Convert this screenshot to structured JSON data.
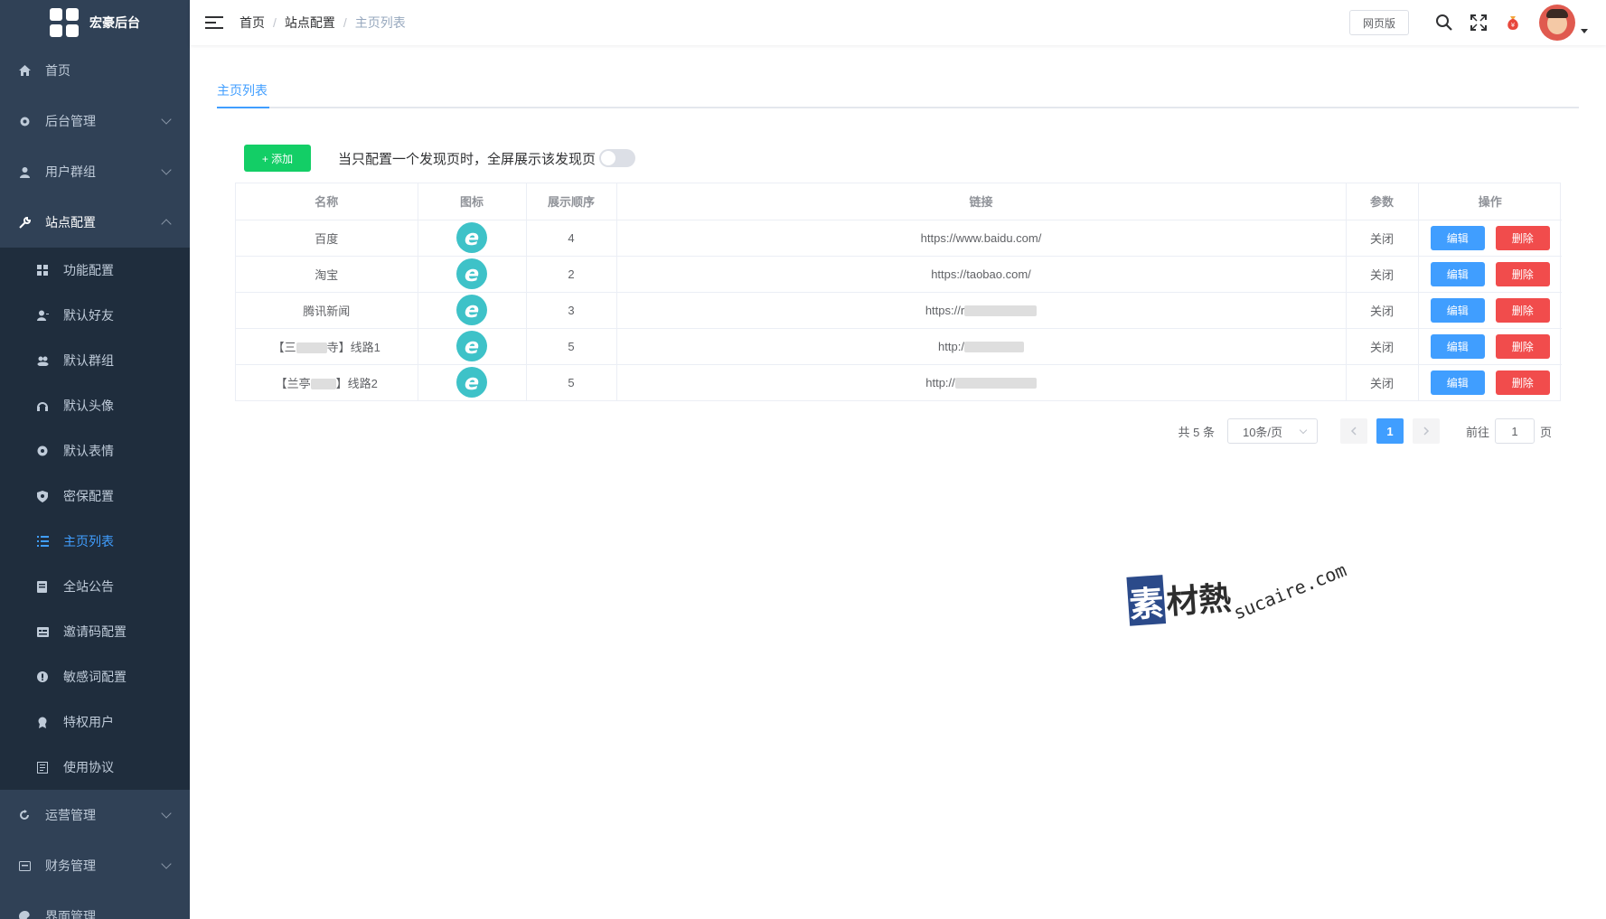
{
  "app": {
    "title": "宏豪后台"
  },
  "sidebar": {
    "items": [
      {
        "label": "首页",
        "icon": "home-icon"
      },
      {
        "label": "后台管理",
        "icon": "gear-icon"
      },
      {
        "label": "用户群组",
        "icon": "user-icon"
      },
      {
        "label": "站点配置",
        "icon": "wrench-icon"
      }
    ],
    "submenu": [
      {
        "label": "功能配置",
        "icon": "grid-icon"
      },
      {
        "label": "默认好友",
        "icon": "user-plus-icon"
      },
      {
        "label": "默认群组",
        "icon": "group-icon"
      },
      {
        "label": "默认头像",
        "icon": "headset-icon"
      },
      {
        "label": "默认表情",
        "icon": "smile-icon"
      },
      {
        "label": "密保配置",
        "icon": "shield-icon"
      },
      {
        "label": "主页列表",
        "icon": "list-icon"
      },
      {
        "label": "全站公告",
        "icon": "notice-icon"
      },
      {
        "label": "邀请码配置",
        "icon": "card-icon"
      },
      {
        "label": "敏感词配置",
        "icon": "alert-icon"
      },
      {
        "label": "特权用户",
        "icon": "badge-icon"
      },
      {
        "label": "使用协议",
        "icon": "document-icon"
      }
    ],
    "bottom_items": [
      {
        "label": "运营管理",
        "icon": "refresh-icon"
      },
      {
        "label": "财务管理",
        "icon": "wallet-icon"
      },
      {
        "label": "界面管理",
        "icon": "palette-icon"
      }
    ]
  },
  "header": {
    "breadcrumb": [
      "首页",
      "站点配置",
      "主页列表"
    ],
    "web_button": "网页版"
  },
  "main": {
    "tab": "主页列表",
    "add_button": "+ 添加",
    "toggle_label": "当只配置一个发现页时，全屏展示该发现页",
    "toggle_on": false,
    "table": {
      "headers": [
        "名称",
        "图标",
        "展示顺序",
        "链接",
        "参数",
        "操作"
      ],
      "rows": [
        {
          "name": "百度",
          "order": "4",
          "link": "https://www.baidu.com/",
          "param": "关闭"
        },
        {
          "name": "淘宝",
          "order": "2",
          "link": "https://taobao.com/",
          "param": "关闭"
        },
        {
          "name": "腾讯新闻",
          "order": "3",
          "link": "https://r",
          "param": "关闭"
        },
        {
          "name_prefix": "【三",
          "name_suffix": "寺】线路1",
          "order": "5",
          "link": "http:/",
          "param": "关闭"
        },
        {
          "name_prefix": "【兰亭",
          "name_suffix": "】线路2",
          "order": "5",
          "link": "http://",
          "param": "关闭"
        }
      ],
      "edit_label": "编辑",
      "delete_label": "删除"
    },
    "pagination": {
      "total": "共 5 条",
      "page_size": "10条/页",
      "current_page": "1",
      "goto_label": "前往",
      "goto_value": "1",
      "page_unit": "页"
    }
  },
  "watermark": {
    "char": "素",
    "text": "材熱",
    "en": "sucaire.com"
  },
  "colors": {
    "sidebar": "#304156",
    "primary": "#409eff",
    "success": "#13ce66",
    "danger": "#f14c4c",
    "icon_teal": "#3ec2c8"
  }
}
